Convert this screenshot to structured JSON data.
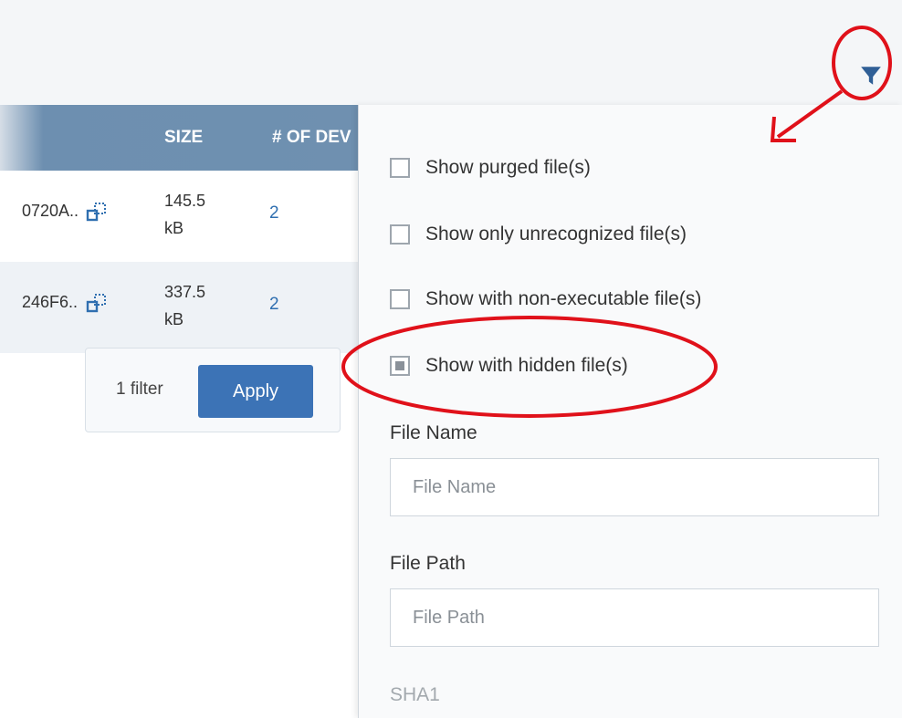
{
  "table": {
    "headers": {
      "size": "SIZE",
      "devices": "# OF DEV"
    },
    "rows": [
      {
        "hash": "0720A..",
        "size_value": "145.5",
        "size_unit": "kB",
        "device_count": "2"
      },
      {
        "hash": "246F6..",
        "size_value": "337.5",
        "size_unit": "kB",
        "device_count": "2"
      }
    ]
  },
  "apply_bar": {
    "filter_count": "1 filter",
    "apply_label": "Apply"
  },
  "filter_panel": {
    "options": [
      {
        "label": "Show purged file(s)",
        "checked": false
      },
      {
        "label": "Show only unrecognized file(s)",
        "checked": false
      },
      {
        "label": "Show with non-executable file(s)",
        "checked": false
      },
      {
        "label": "Show with hidden file(s)",
        "checked": true
      }
    ],
    "file_name": {
      "label": "File Name",
      "placeholder": "File Name",
      "value": ""
    },
    "file_path": {
      "label": "File Path",
      "placeholder": "File Path",
      "value": ""
    },
    "sha1": {
      "label": "SHA1"
    }
  },
  "icons": {
    "filter": "funnel-icon",
    "copy": "copy-icon"
  },
  "colors": {
    "accent": "#3c73b6",
    "annotation": "#e0111a",
    "header": "#6f90b0",
    "link": "#2f6fb0"
  }
}
